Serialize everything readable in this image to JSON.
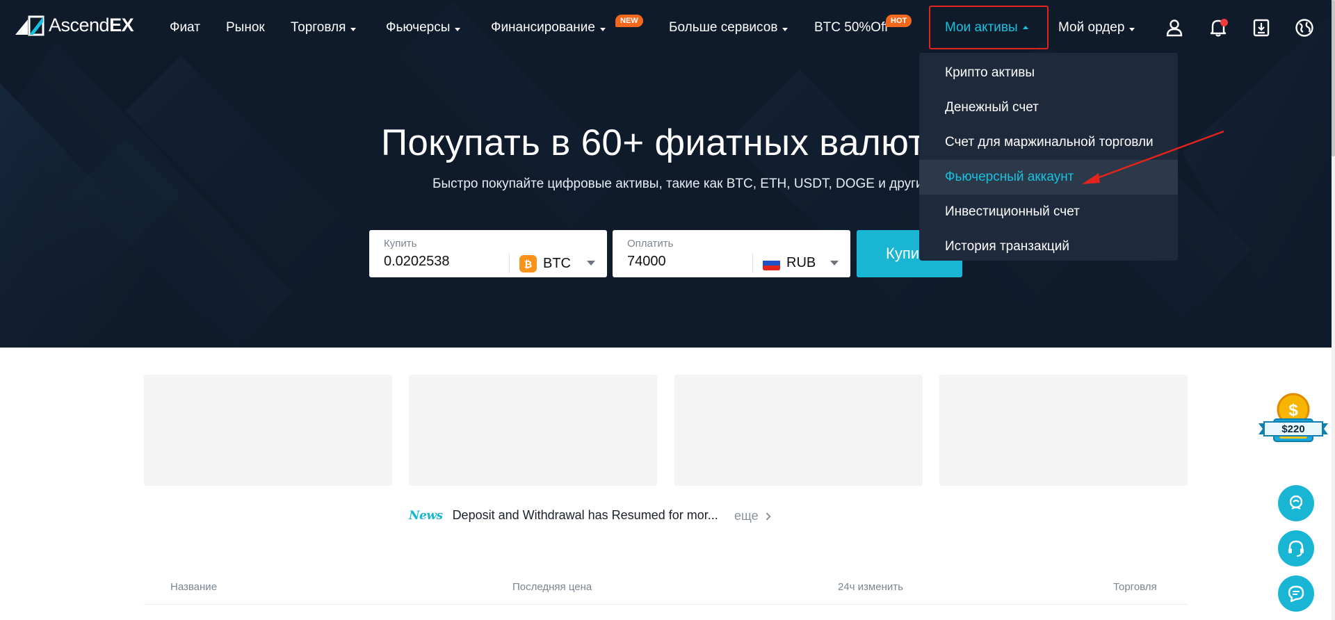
{
  "header": {
    "logo_prefix": "Ascend",
    "logo_suffix": "EX",
    "nav": [
      {
        "label": "Фиат"
      },
      {
        "label": "Рынок"
      },
      {
        "label": "Торговля"
      },
      {
        "label": "Фьючерсы"
      },
      {
        "label": "Финансирование",
        "badge": "NEW"
      },
      {
        "label": "Больше сервисов"
      },
      {
        "label": "BTC 50%Off",
        "badge": "HOT"
      },
      {
        "label": "Мои активы"
      },
      {
        "label": "Мой ордер"
      }
    ],
    "icons": [
      "user-icon",
      "bell-icon",
      "download-icon",
      "globe-icon"
    ]
  },
  "dropdown": {
    "items": [
      {
        "label": "Крипто активы"
      },
      {
        "label": "Денежный счет"
      },
      {
        "label": "Счет для маржинальной торговли"
      },
      {
        "label": "Фьючерсный аккаунт"
      },
      {
        "label": "Инвестиционный счет"
      },
      {
        "label": "История транзакций"
      }
    ]
  },
  "hero": {
    "title": "Покупать в 60+ фиатных валюта",
    "subtitle": "Быстро покупайте цифровые активы, такие как BTC, ETH, USDT, DOGE и другие",
    "buy": {
      "label": "Купить",
      "value": "0.0202538",
      "currency": "BTC",
      "currency_icon": "₿"
    },
    "pay": {
      "label": "Оплатить",
      "value": "74000",
      "currency": "RUB"
    },
    "button": "Купи"
  },
  "news": {
    "logo": "News",
    "text": "Deposit and Withdrawal has Resumed for mor...",
    "more": "еще"
  },
  "table": {
    "headers": [
      "Название",
      "Последняя цена",
      "24ч изменить",
      "Торговля"
    ]
  },
  "promo": {
    "amount": "$220"
  },
  "colors": {
    "accent": "#18c1de",
    "hero_bg": "#0e1a2a",
    "dropdown_bg": "#1e2a3b",
    "highlight_box": "#e3241c",
    "badge": "#f4681d"
  }
}
